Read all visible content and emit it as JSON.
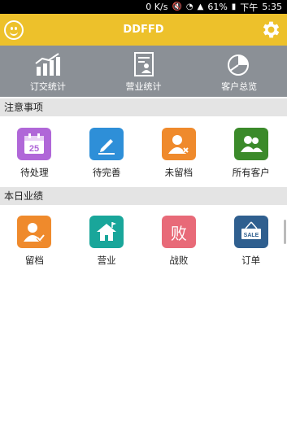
{
  "status": {
    "speed": "0 K/s",
    "battery": "61%",
    "period": "下午",
    "time": "5:35"
  },
  "appbar": {
    "title": "DDFFD",
    "colors": {
      "bar": "#edc12b"
    }
  },
  "topnav": {
    "items": [
      {
        "label": "订交统计",
        "icon": "bar-chart-icon"
      },
      {
        "label": "营业统计",
        "icon": "report-icon"
      },
      {
        "label": "客户总览",
        "icon": "pie-chart-icon"
      }
    ]
  },
  "attention": {
    "header": "注意事项",
    "items": [
      {
        "label": "待处理",
        "icon": "calendar-icon",
        "color": "#b067d8",
        "day": "25"
      },
      {
        "label": "待完善",
        "icon": "edit-icon",
        "color": "#2e8fd8"
      },
      {
        "label": "未留档",
        "icon": "user-remove-icon",
        "color": "#ef8a2c"
      },
      {
        "label": "所有客户",
        "icon": "group-icon",
        "color": "#3b8a2a"
      }
    ]
  },
  "today": {
    "header": "本日业绩",
    "items": [
      {
        "label": "留档",
        "icon": "user-check-icon",
        "color": "#ef8a2c"
      },
      {
        "label": "营业",
        "icon": "house-icon",
        "color": "#19a69a"
      },
      {
        "label": "战败",
        "icon": "defeat-icon",
        "color": "#e86a78",
        "glyph": "败"
      },
      {
        "label": "订单",
        "icon": "sale-sign-icon",
        "color": "#2f5f8f",
        "sign": "SALE"
      }
    ]
  }
}
